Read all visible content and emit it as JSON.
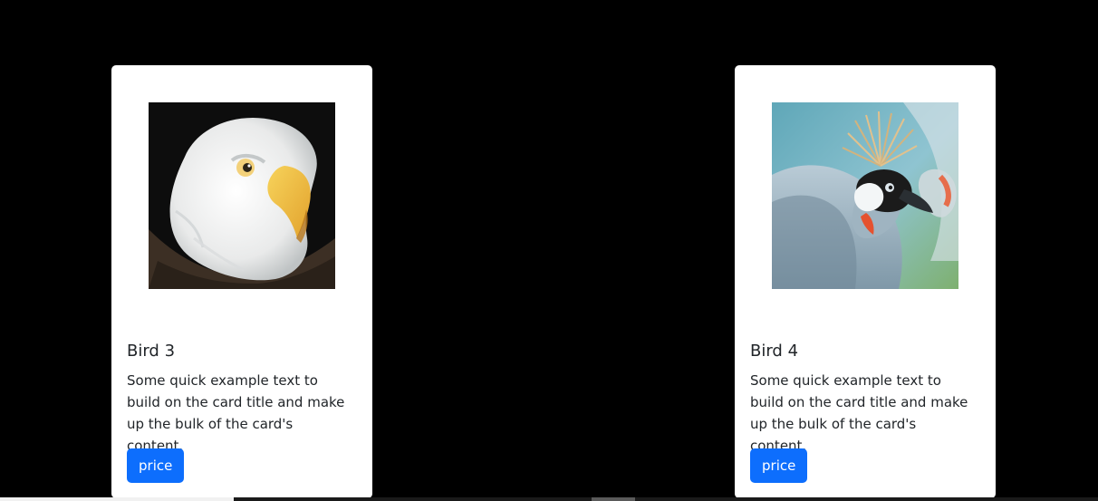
{
  "cards": [
    {
      "title": "Bird 3",
      "text": "Some quick example text to build on the card title and make up the bulk of the card's content.",
      "button_label": "price",
      "image": "bald-eagle-photo"
    },
    {
      "title": "Bird 4",
      "text": "Some quick example text to build on the card title and make up the bulk of the card's content.",
      "button_label": "price",
      "image": "crowned-crane-photo"
    }
  ],
  "colors": {
    "background": "#000000",
    "card": "#ffffff",
    "button": "#0d6efd",
    "text": "#212529"
  }
}
